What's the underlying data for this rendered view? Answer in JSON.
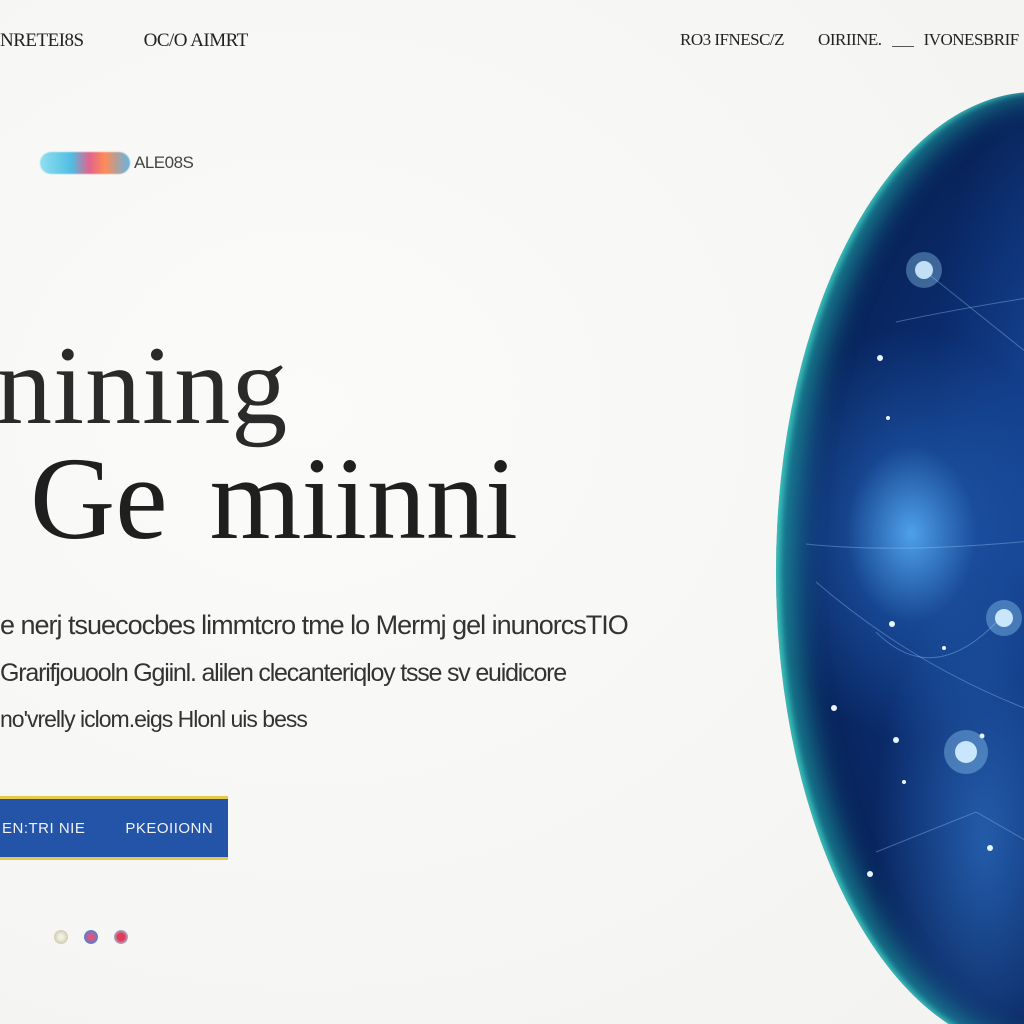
{
  "nav": {
    "left": [
      "NRETEI8S",
      "OC/O AIMRT"
    ],
    "right": [
      "RO3 IFNESC/Z",
      "OIRIINE.",
      "IVONESBRIF"
    ]
  },
  "badge": {
    "label": "ALE08S"
  },
  "hero": {
    "headline_line1": "nining",
    "headline_line2_word1": "Ge",
    "headline_line2_word2": "miinni",
    "body_lines": [
      "e nerj tsuecocbes limmtcro tme lo Mermj gel inunorcsTIO",
      "Grarifjouooln Ggiinl. alilen clecanteriqloy tsse sv euidicore",
      "no'vrelly iclom.eigs Hlonl uis bess"
    ]
  },
  "cta": {
    "label_a": "EN:TRI NIE",
    "label_b": "PKEOIIONN"
  },
  "carousel": {
    "count": 3,
    "active_index": 2
  },
  "colors": {
    "cta_bg": "#2354a8",
    "cta_border": "#e6c94a",
    "globe_core": "#0a2a6a",
    "globe_rim": "#2cd8c8"
  },
  "icons": [
    "globe-graphic",
    "carousel-dot"
  ]
}
